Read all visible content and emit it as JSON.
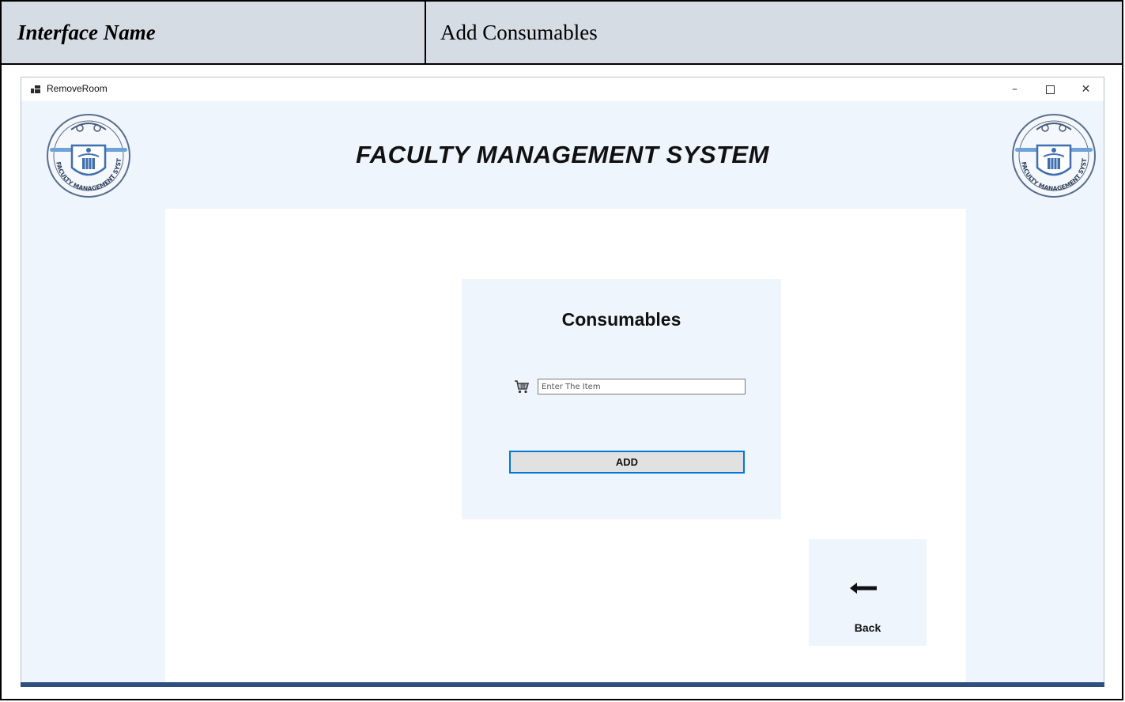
{
  "doc": {
    "label_cell": "Interface Name",
    "value_cell": "Add Consumables"
  },
  "window": {
    "title": "RemoveRoom",
    "controls": {
      "minimize": "–",
      "close": "✕"
    }
  },
  "banner": {
    "title": "FACULTY MANAGEMENT SYSTEM",
    "logo_text": "FACULTY MANAGEMENT SYSTEM"
  },
  "form": {
    "title": "Consumables",
    "item_placeholder": "Enter The Item",
    "item_value": "",
    "add_label": "ADD"
  },
  "nav": {
    "back_label": "Back"
  },
  "colors": {
    "doc_header_bg": "#d5dce4",
    "panel_bg": "#eef5fd",
    "accent_border": "#0078d7",
    "button_bg": "#e1e1e1",
    "logo_blue": "#3f6fae",
    "taskbar": "#2e4f7e"
  },
  "icons": {
    "app": "app-window-icon",
    "cart": "shopping-cart-icon",
    "back": "left-arrow-icon"
  }
}
